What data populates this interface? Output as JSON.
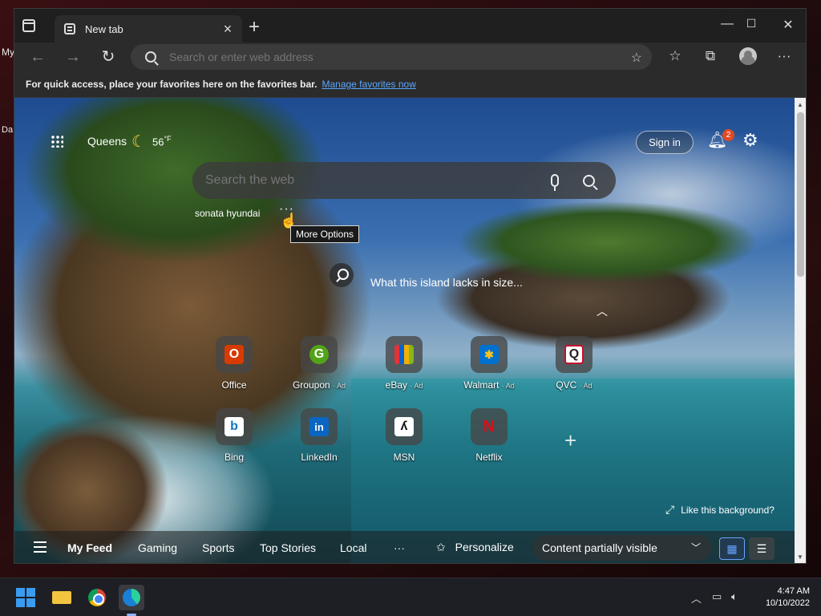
{
  "desktop": {
    "edge_text_1": "My",
    "edge_text_2": "Da"
  },
  "tab": {
    "title": "New tab"
  },
  "window_controls": {
    "minimize": "—",
    "maximize": "☐",
    "close": "✕"
  },
  "toolbar": {
    "address_placeholder": "Search or enter web address"
  },
  "favorites_bar": {
    "message": "For quick access, place your favorites here on the favorites bar.",
    "link": "Manage favorites now"
  },
  "ntp": {
    "location": "Queens",
    "temperature": "56",
    "temperature_unit": "°F",
    "sign_in": "Sign in",
    "notification_count": "2",
    "search_placeholder": "Search the web",
    "trending": "sonata hyundai",
    "more_dots": "···",
    "tooltip": "More Options",
    "story": "What this island lacks in size...",
    "like_background": "Like this background?"
  },
  "quick_links": [
    {
      "label": "Office",
      "ad": "",
      "color": "#d83b01",
      "glyph": "O"
    },
    {
      "label": "Groupon",
      "ad": "· Ad",
      "color": "#53a318",
      "glyph": "G"
    },
    {
      "label": "eBay",
      "ad": "· Ad",
      "color": "#e53238",
      "glyph": "▥"
    },
    {
      "label": "Walmart",
      "ad": "· Ad",
      "color": "#0071ce",
      "glyph": "✱"
    },
    {
      "label": "QVC",
      "ad": "· Ad",
      "color": "#ffffff",
      "glyph": "Q"
    },
    {
      "label": "Bing",
      "ad": "",
      "color": "#ffffff",
      "glyph": "b"
    },
    {
      "label": "LinkedIn",
      "ad": "",
      "color": "#0a66c2",
      "glyph": "in"
    },
    {
      "label": "MSN",
      "ad": "",
      "color": "#ffffff",
      "glyph": "ʎ"
    },
    {
      "label": "Netflix",
      "ad": "",
      "color": "#e50914",
      "glyph": "N"
    }
  ],
  "feed": {
    "items": [
      "My Feed",
      "Gaming",
      "Sports",
      "Top Stories",
      "Local"
    ],
    "more": "···",
    "personalize": "Personalize",
    "content_visibility": "Content partially visible"
  },
  "taskbar": {
    "time": "4:47 AM",
    "date": "10/10/2022",
    "accent": "#3a9cf0"
  }
}
